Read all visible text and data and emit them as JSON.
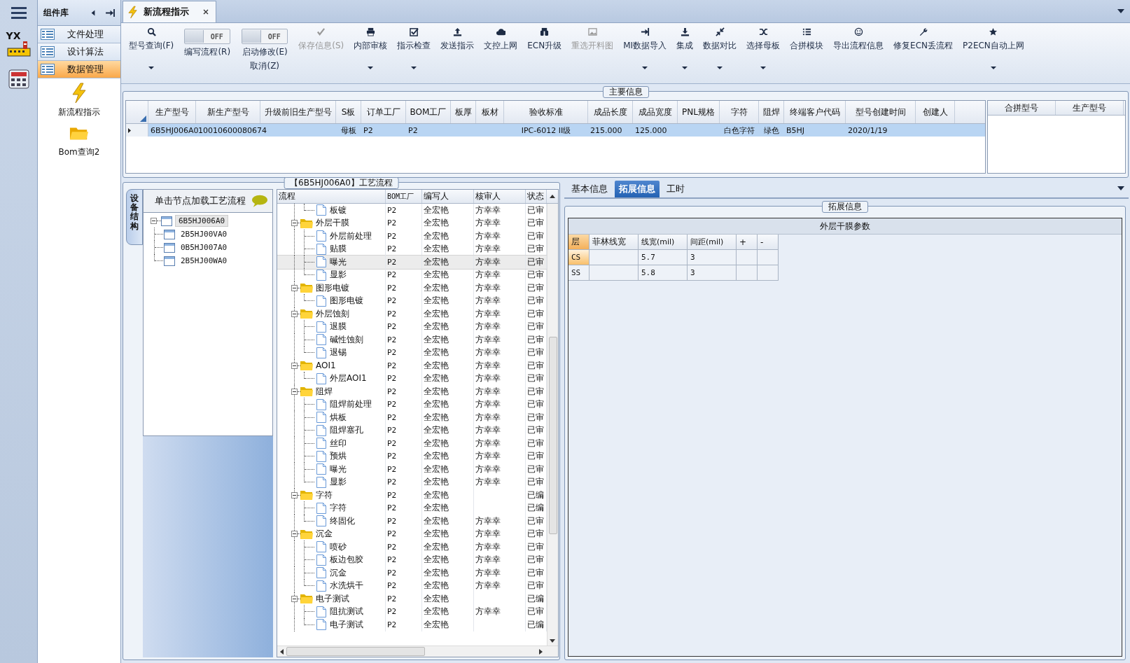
{
  "rail": {
    "logo_text": "YX"
  },
  "sidebar": {
    "title": "组件库",
    "nav_items": [
      {
        "label": "文件处理",
        "selected": false
      },
      {
        "label": "设计算法",
        "selected": false
      },
      {
        "label": "数据管理",
        "selected": true
      }
    ],
    "launch_items": [
      {
        "label": "新流程指示"
      },
      {
        "label": "Bom查询2"
      }
    ]
  },
  "document_tab": {
    "title": "新流程指示",
    "selected": true
  },
  "toolbar": [
    {
      "kind": "button",
      "label": "型号查询(F)",
      "disabled": false,
      "dropdown": true
    },
    {
      "kind": "toggle",
      "on": false,
      "switch_text": "OFF",
      "labels": [
        "编写流程(R)"
      ]
    },
    {
      "kind": "toggle",
      "on": false,
      "switch_text": "OFF",
      "labels": [
        "启动修改(E)",
        "取消(Z)"
      ]
    },
    {
      "kind": "button",
      "label": "保存信息(S)",
      "disabled": true,
      "dropdown": false
    },
    {
      "kind": "button",
      "label": "内部审核",
      "disabled": false,
      "dropdown": true
    },
    {
      "kind": "button",
      "label": "指示检查",
      "disabled": false,
      "dropdown": true
    },
    {
      "kind": "button",
      "label": "发送指示",
      "disabled": false,
      "dropdown": false
    },
    {
      "kind": "button",
      "label": "文控上网",
      "disabled": false,
      "dropdown": false
    },
    {
      "kind": "button",
      "label": "ECN升级",
      "disabled": false,
      "dropdown": false
    },
    {
      "kind": "button",
      "label": "重选开料图",
      "disabled": true,
      "dropdown": false
    },
    {
      "kind": "button",
      "label": "MI数据导入",
      "disabled": false,
      "dropdown": true
    },
    {
      "kind": "button",
      "label": "集成",
      "disabled": false,
      "dropdown": true
    },
    {
      "kind": "button",
      "label": "数据对比",
      "disabled": false,
      "dropdown": true
    },
    {
      "kind": "button",
      "label": "选择母板",
      "disabled": false,
      "dropdown": true
    },
    {
      "kind": "button",
      "label": "合拼模块",
      "disabled": false,
      "dropdown": false
    },
    {
      "kind": "button",
      "label": "导出流程信息",
      "disabled": false,
      "dropdown": false
    },
    {
      "kind": "button",
      "label": "修复ECN丢流程",
      "disabled": false,
      "dropdown": false
    },
    {
      "kind": "button",
      "label": "P2ECN自动上网",
      "disabled": false,
      "dropdown": true
    }
  ],
  "main_info": {
    "title": "主要信息",
    "columns": [
      "生产型号",
      "新生产型号",
      "升级前旧生产型号",
      "S板",
      "订单工厂",
      "BOM工厂",
      "板厚",
      "板材",
      "验收标准",
      "成品长度",
      "成品宽度",
      "PNL规格",
      "字符",
      "阻焊",
      "终端客户代码",
      "型号创建时间",
      "创建人"
    ],
    "rows": [
      {
        "selected": true,
        "cells": [
          "6B5HJ006A0",
          "10010600080674",
          null,
          "母板",
          "P2",
          "P2",
          null,
          null,
          "IPC-6012 II级",
          "215.000",
          "125.000",
          null,
          "白色字符",
          "绿色",
          "B5HJ",
          "2020/1/19",
          null
        ]
      }
    ],
    "merge_columns": [
      "合拼型号",
      "生产型号"
    ]
  },
  "process": {
    "title": "【6B5HJ006A0】工艺流程",
    "side_tab": "设备结构",
    "tree_hint": "单击节点加载工艺流程",
    "device_tree": [
      {
        "name": "6B5HJ006A0",
        "selected": true,
        "expanded": true,
        "children": [
          {
            "name": "2B5HJ00VA0",
            "selected": false
          },
          {
            "name": "0B5HJ007A0",
            "selected": false
          },
          {
            "name": "2B5HJ00WA0",
            "selected": false
          }
        ]
      }
    ],
    "columns": [
      "流程",
      "BOM工厂",
      "编写人",
      "核审人",
      "状态"
    ],
    "rows": [
      {
        "kind": "continued",
        "children": [
          {
            "name": "板镀",
            "bom": "P2",
            "writer": "全宏艳",
            "reviewer": "方幸幸",
            "status": "已审",
            "selected": false
          }
        ]
      },
      {
        "kind": "group",
        "name": "外层干膜",
        "bom": "P2",
        "writer": "全宏艳",
        "reviewer": "方幸幸",
        "status": "已审",
        "expanded": true,
        "selected": false,
        "children": [
          {
            "name": "外层前处理",
            "bom": "P2",
            "writer": "全宏艳",
            "reviewer": "方幸幸",
            "status": "已审",
            "selected": false
          },
          {
            "name": "贴膜",
            "bom": "P2",
            "writer": "全宏艳",
            "reviewer": "方幸幸",
            "status": "已审",
            "selected": false
          },
          {
            "name": "曝光",
            "bom": "P2",
            "writer": "全宏艳",
            "reviewer": "方幸幸",
            "status": "已审",
            "selected": true
          },
          {
            "name": "显影",
            "bom": "P2",
            "writer": "全宏艳",
            "reviewer": "方幸幸",
            "status": "已审",
            "selected": false
          }
        ]
      },
      {
        "kind": "group",
        "name": "图形电镀",
        "bom": "P2",
        "writer": "全宏艳",
        "reviewer": "方幸幸",
        "status": "已审",
        "expanded": true,
        "selected": false,
        "children": [
          {
            "name": "图形电镀",
            "bom": "P2",
            "writer": "全宏艳",
            "reviewer": "方幸幸",
            "status": "已审",
            "selected": false
          }
        ]
      },
      {
        "kind": "group",
        "name": "外层蚀刻",
        "bom": "P2",
        "writer": "全宏艳",
        "reviewer": "方幸幸",
        "status": "已审",
        "expanded": true,
        "selected": false,
        "children": [
          {
            "name": "退膜",
            "bom": "P2",
            "writer": "全宏艳",
            "reviewer": "方幸幸",
            "status": "已审",
            "selected": false
          },
          {
            "name": "碱性蚀刻",
            "bom": "P2",
            "writer": "全宏艳",
            "reviewer": "方幸幸",
            "status": "已审",
            "selected": false
          },
          {
            "name": "退锡",
            "bom": "P2",
            "writer": "全宏艳",
            "reviewer": "方幸幸",
            "status": "已审",
            "selected": false
          }
        ]
      },
      {
        "kind": "group",
        "name": "AOI1",
        "bom": "P2",
        "writer": "全宏艳",
        "reviewer": "方幸幸",
        "status": "已审",
        "expanded": true,
        "selected": false,
        "children": [
          {
            "name": "外层AOI1",
            "bom": "P2",
            "writer": "全宏艳",
            "reviewer": "方幸幸",
            "status": "已审",
            "selected": false
          }
        ]
      },
      {
        "kind": "group",
        "name": "阻焊",
        "bom": "P2",
        "writer": "全宏艳",
        "reviewer": "方幸幸",
        "status": "已审",
        "expanded": true,
        "selected": false,
        "children": [
          {
            "name": "阻焊前处理",
            "bom": "P2",
            "writer": "全宏艳",
            "reviewer": "方幸幸",
            "status": "已审",
            "selected": false
          },
          {
            "name": "烘板",
            "bom": "P2",
            "writer": "全宏艳",
            "reviewer": "方幸幸",
            "status": "已审",
            "selected": false
          },
          {
            "name": "阻焊塞孔",
            "bom": "P2",
            "writer": "全宏艳",
            "reviewer": "方幸幸",
            "status": "已审",
            "selected": false
          },
          {
            "name": "丝印",
            "bom": "P2",
            "writer": "全宏艳",
            "reviewer": "方幸幸",
            "status": "已审",
            "selected": false
          },
          {
            "name": "预烘",
            "bom": "P2",
            "writer": "全宏艳",
            "reviewer": "方幸幸",
            "status": "已审",
            "selected": false
          },
          {
            "name": "曝光",
            "bom": "P2",
            "writer": "全宏艳",
            "reviewer": "方幸幸",
            "status": "已审",
            "selected": false
          },
          {
            "name": "显影",
            "bom": "P2",
            "writer": "全宏艳",
            "reviewer": "方幸幸",
            "status": "已审",
            "selected": false
          }
        ]
      },
      {
        "kind": "group",
        "name": "字符",
        "bom": "P2",
        "writer": "全宏艳",
        "status": "已编",
        "expanded": true,
        "selected": false,
        "children": [
          {
            "name": "字符",
            "bom": "P2",
            "writer": "全宏艳",
            "status": "已编",
            "selected": false
          },
          {
            "name": "终固化",
            "bom": "P2",
            "writer": "全宏艳",
            "reviewer": "方幸幸",
            "status": "已审",
            "selected": false
          }
        ]
      },
      {
        "kind": "group",
        "name": "沉金",
        "bom": "P2",
        "writer": "全宏艳",
        "reviewer": "方幸幸",
        "status": "已审",
        "expanded": true,
        "selected": false,
        "children": [
          {
            "name": "喷砂",
            "bom": "P2",
            "writer": "全宏艳",
            "reviewer": "方幸幸",
            "status": "已审",
            "selected": false
          },
          {
            "name": "板边包胶",
            "bom": "P2",
            "writer": "全宏艳",
            "reviewer": "方幸幸",
            "status": "已审",
            "selected": false
          },
          {
            "name": "沉金",
            "bom": "P2",
            "writer": "全宏艳",
            "reviewer": "方幸幸",
            "status": "已审",
            "selected": false
          },
          {
            "name": "水洗烘干",
            "bom": "P2",
            "writer": "全宏艳",
            "reviewer": "方幸幸",
            "status": "已审",
            "selected": false
          }
        ]
      },
      {
        "kind": "group",
        "name": "电子测试",
        "bom": "P2",
        "writer": "全宏艳",
        "status": "已编",
        "expanded": true,
        "selected": false,
        "children": [
          {
            "name": "阻抗测试",
            "bom": "P2",
            "writer": "全宏艳",
            "reviewer": "方幸幸",
            "status": "已审",
            "selected": false
          },
          {
            "name": "电子测试",
            "bom": "P2",
            "writer": "全宏艳",
            "status": "已编",
            "selected": false
          }
        ]
      }
    ]
  },
  "detail": {
    "tabs": [
      {
        "label": "基本信息",
        "selected": false
      },
      {
        "label": "拓展信息",
        "selected": true
      },
      {
        "label": "工时",
        "selected": false
      }
    ],
    "group_title": "拓展信息",
    "table_title": "外层干膜参数",
    "columns": [
      "层",
      "菲林线宽",
      "线宽(mil)",
      "间距(mil)",
      "+",
      "-"
    ],
    "rows": [
      {
        "selected": true,
        "cells": [
          "CS",
          null,
          "5.7",
          "3",
          null,
          null
        ]
      },
      {
        "selected": false,
        "cells": [
          "SS",
          null,
          "5.8",
          "3",
          null,
          null
        ]
      }
    ]
  }
}
